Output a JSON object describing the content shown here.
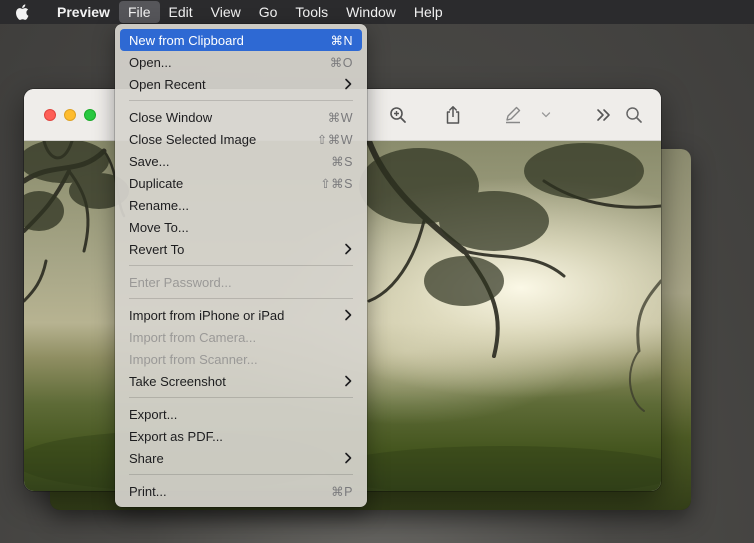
{
  "menubar": {
    "app_name": "Preview",
    "items": [
      {
        "label": "File"
      },
      {
        "label": "Edit"
      },
      {
        "label": "View"
      },
      {
        "label": "Go"
      },
      {
        "label": "Tools"
      },
      {
        "label": "Window"
      },
      {
        "label": "Help"
      }
    ]
  },
  "file_menu": {
    "groups": [
      [
        {
          "label": "New from Clipboard",
          "shortcut": "⌘N"
        },
        {
          "label": "Open...",
          "shortcut": "⌘O"
        },
        {
          "label": "Open Recent",
          "submenu": true
        }
      ],
      [
        {
          "label": "Close Window",
          "shortcut": "⌘W"
        },
        {
          "label": "Close Selected Image",
          "shortcut": "⇧⌘W"
        },
        {
          "label": "Save...",
          "shortcut": "⌘S"
        },
        {
          "label": "Duplicate",
          "shortcut": "⇧⌘S"
        },
        {
          "label": "Rename..."
        },
        {
          "label": "Move To..."
        },
        {
          "label": "Revert To",
          "submenu": true
        }
      ],
      [
        {
          "label": "Enter Password...",
          "disabled": true
        }
      ],
      [
        {
          "label": "Import from iPhone or iPad",
          "submenu": true
        },
        {
          "label": "Import from Camera...",
          "disabled": true
        },
        {
          "label": "Import from Scanner...",
          "disabled": true
        },
        {
          "label": "Take Screenshot",
          "submenu": true
        }
      ],
      [
        {
          "label": "Export..."
        },
        {
          "label": "Export as PDF..."
        },
        {
          "label": "Share",
          "submenu": true
        }
      ],
      [
        {
          "label": "Print...",
          "shortcut": "⌘P"
        }
      ]
    ]
  },
  "toolbar": {
    "icons": [
      "zoom-in-icon",
      "share-icon",
      "markup-pen-icon",
      "chevron-down-icon",
      "more-chevrons-icon",
      "search-icon"
    ]
  },
  "colors": {
    "menu_highlight": "#2e69d3",
    "menubar_bg": "#2b2b2d",
    "close": "#fe5f57",
    "minimize": "#febc2e",
    "zoom": "#28c840"
  }
}
